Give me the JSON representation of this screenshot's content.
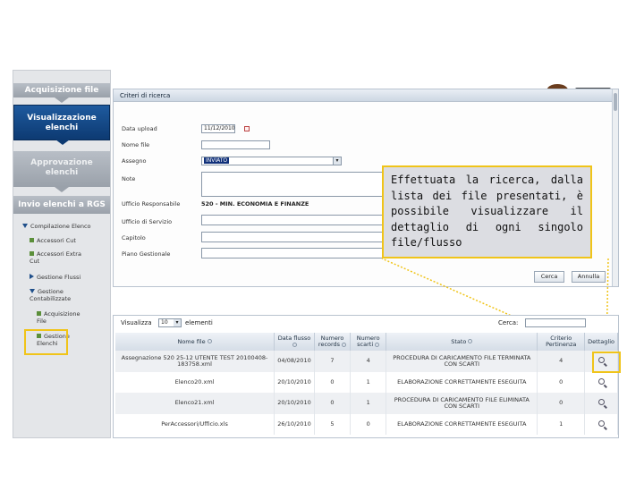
{
  "sidebar": {
    "steps": [
      {
        "label": "Acquisizione file",
        "state": "inactive"
      },
      {
        "label": "Visualizzazione elenchi",
        "state": "active"
      },
      {
        "label": "Approvazione elenchi",
        "state": "inactive"
      },
      {
        "label": "Invio elenchi a RGS",
        "state": "inactive"
      }
    ],
    "tree": [
      {
        "label": "Compilazione Elenco",
        "level": 0,
        "marker": "expanded"
      },
      {
        "label": "Accessori Cut",
        "level": 1,
        "marker": "bullet"
      },
      {
        "label": "Accessori Extra Cut",
        "level": 1,
        "marker": "bullet"
      },
      {
        "label": "Gestione Flussi",
        "level": 1,
        "marker": "collapsed"
      },
      {
        "label": "Gestione Contabilizzate",
        "level": 1,
        "marker": "expanded"
      },
      {
        "label": "Acquisizione File",
        "level": 2,
        "marker": "bullet"
      },
      {
        "label": "Gestione Elenchi",
        "level": 2,
        "marker": "bullet",
        "highlighted": true
      }
    ]
  },
  "form": {
    "title": "Criteri di ricerca",
    "fields": [
      {
        "label": "Data upload",
        "value": "11/12/2010"
      },
      {
        "label": "Nome file",
        "value": ""
      },
      {
        "label": "Assegno",
        "value": "INVIATO"
      },
      {
        "label": "Note",
        "value": ""
      },
      {
        "label": "Ufficio Responsabile",
        "value": "520 - MIN. ECONOMIA E FINANZE"
      },
      {
        "label": "Ufficio di Servizio",
        "value": ""
      },
      {
        "label": "Capitolo",
        "value": ""
      },
      {
        "label": "Piano Gestionale",
        "value": ""
      }
    ],
    "search_button": "Cerca",
    "cancel_button": "Annulla"
  },
  "callout": {
    "text": "Effettuata la ricerca, dalla lista dei file presentati, è possibile visualizzare il dettaglio di ogni singolo file/flusso"
  },
  "results": {
    "show_label": "Visualizza",
    "page_size": "10",
    "elements_label": "elementi",
    "search_label": "Cerca:",
    "search_value": "",
    "columns": [
      "Nome file",
      "Data flusso",
      "Numero records",
      "Numero scarti",
      "Stato",
      "Criterio Pertinenza",
      "Dettaglio"
    ],
    "rows": [
      {
        "name": "Assegnazione 520 25-12 UTENTE TEST 20100408-183758.xml",
        "date": "04/08/2010",
        "records": "7",
        "discards": "4",
        "status": "PROCEDURA DI CARICAMENTO FILE TERMINATA CON SCARTI",
        "criterion": "4"
      },
      {
        "name": "Elenco20.xml",
        "date": "20/10/2010",
        "records": "0",
        "discards": "1",
        "status": "ELABORAZIONE CORRETTAMENTE ESEGUITA",
        "criterion": "0"
      },
      {
        "name": "Elenco21.xml",
        "date": "20/10/2010",
        "records": "0",
        "discards": "1",
        "status": "PROCEDURA DI CARICAMENTO FILE ELIMINATA CON SCARTI",
        "criterion": "0"
      },
      {
        "name": "PerAccessori/Ufficio.xls",
        "date": "26/10/2010",
        "records": "5",
        "discards": "0",
        "status": "ELABORAZIONE CORRETTAMENTE ESEGUITA",
        "criterion": "1"
      }
    ]
  },
  "icons": {
    "calendar": "calendar-icon",
    "detail": "magnifier-icon",
    "user": "user-at-computer-illustration"
  },
  "colors": {
    "highlight": "#f0c419",
    "active_step": "#0d3a72",
    "callout_bg": "#dcdde2"
  }
}
